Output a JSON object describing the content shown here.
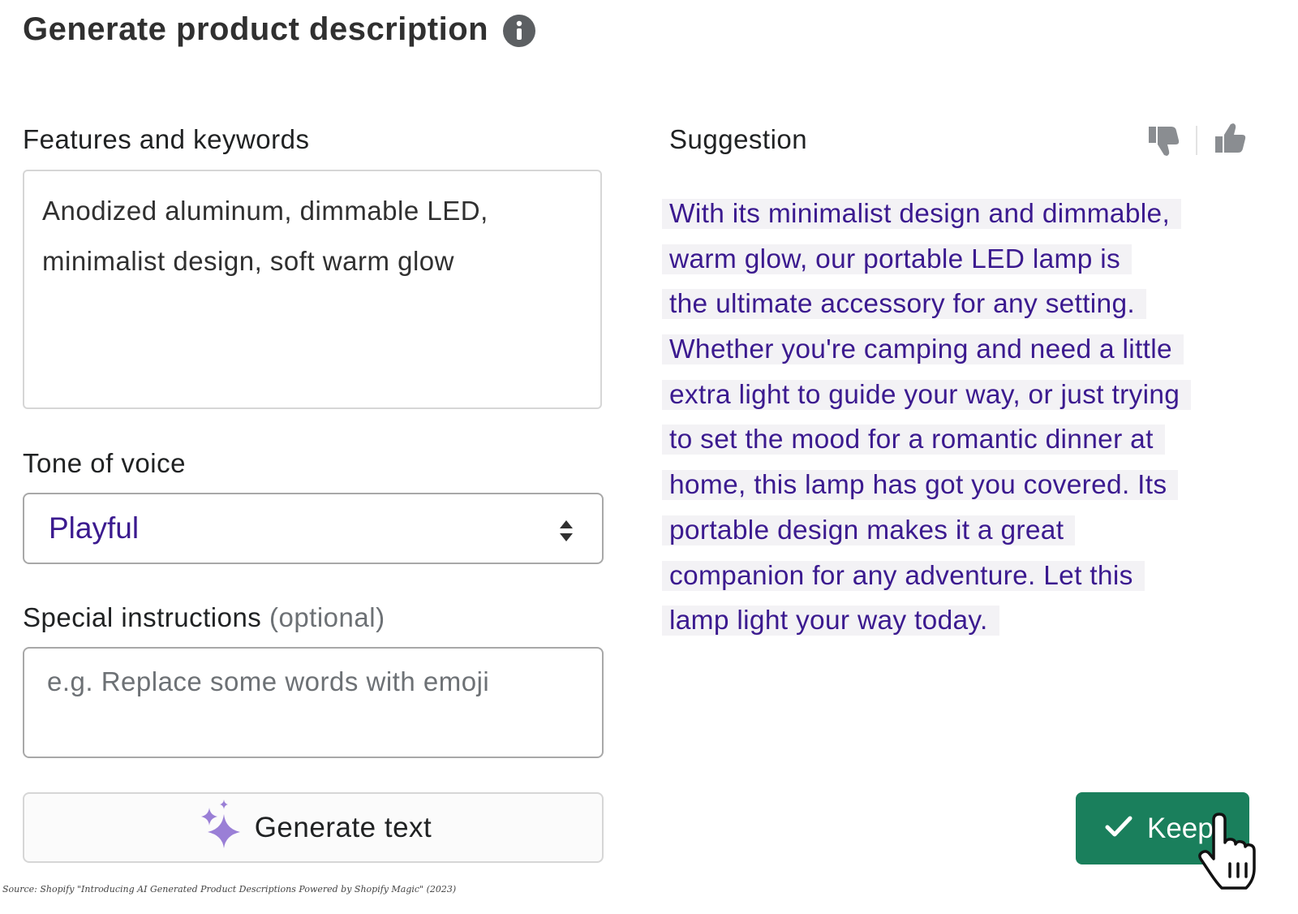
{
  "header": {
    "title": "Generate product description"
  },
  "features": {
    "label": "Features and keywords",
    "lines": [
      "Anodized aluminum, dimmable LED,",
      "minimalist design, soft warm glow"
    ]
  },
  "tone": {
    "label": "Tone of voice",
    "selected": "Playful"
  },
  "instructions": {
    "label": "Special instructions",
    "optional": "(optional)",
    "placeholder": "e.g. Replace some words with emoji"
  },
  "generate_button": {
    "label": "Generate text"
  },
  "suggestion": {
    "label": "Suggestion",
    "lines": [
      "With its minimalist design and dimmable,",
      "warm glow, our portable LED lamp is",
      "the ultimate accessory for any setting.",
      "Whether you're camping and need a little",
      "extra light to guide your way, or just trying",
      "to set the mood for a romantic dinner at",
      "home, this lamp has got you covered. Its",
      "portable design makes it a great",
      "companion for any adventure. Let this",
      "lamp light your way today."
    ]
  },
  "keep_button": {
    "label": "Keep"
  },
  "source": "Source: Shopify \"Introducing AI Generated Product Descriptions Powered by Shopify Magic\" (2023)",
  "colors": {
    "accent_text": "#3b1a8f",
    "keep_green": "#1a7f5c",
    "sparkle": "#9a7fd6"
  },
  "icons": [
    "info-icon",
    "select-arrows-icon",
    "sparkles-icon",
    "thumbs-down-icon",
    "thumbs-up-icon",
    "checkmark-icon",
    "hand-cursor-icon"
  ]
}
